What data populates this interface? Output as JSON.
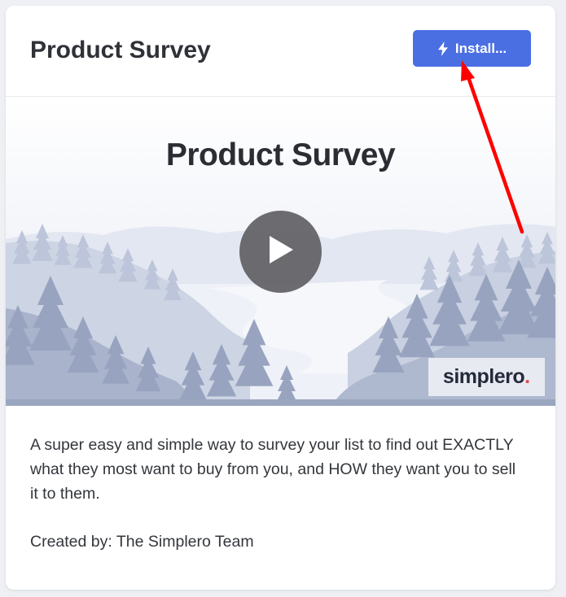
{
  "card": {
    "title": "Product Survey",
    "install_button": {
      "label": "Install...",
      "icon": "lightning-bolt-icon",
      "color": "#4a6fe3"
    }
  },
  "video": {
    "title": "Product Survey",
    "play_icon": "play-icon",
    "brand": {
      "name": "simplero",
      "dot": ".",
      "dot_color": "#e5484d"
    }
  },
  "description": "A super easy and simple way to survey your list to find out EXACTLY what they most want to buy from you, and HOW they want you to sell it to them.",
  "created_by": "Created by: The Simplero Team",
  "annotation": {
    "arrow_color": "#ff0000",
    "points_to": "install-button"
  }
}
